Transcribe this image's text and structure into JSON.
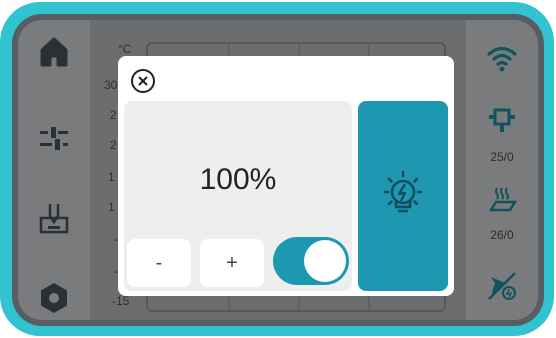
{
  "background_chart": {
    "unit_label": "°C",
    "tick_labels": [
      "30",
      "2",
      "2",
      "1",
      "1",
      "-",
      "-",
      "-15"
    ]
  },
  "sidebar_left": {
    "items": [
      {
        "icon": "home-icon"
      },
      {
        "icon": "sliders-icon"
      },
      {
        "icon": "printer-icon"
      },
      {
        "icon": "settings-hex-icon"
      }
    ]
  },
  "sidebar_right": {
    "wifi_icon": "wifi-icon",
    "nozzle": {
      "icon": "nozzle-icon",
      "value": "25/0"
    },
    "bed": {
      "icon": "heated-bed-icon",
      "value": "26/0"
    },
    "fan_icon": "fan-icon"
  },
  "light_dialog": {
    "close_icon": "close-icon",
    "brightness": "100%",
    "brightness_fraction": 1.0,
    "decrease_label": "-",
    "increase_label": "+",
    "toggle_on": true,
    "light_icon": "bulb-icon"
  },
  "colors": {
    "accent": "#1e97b0",
    "frame": "#31c3cf",
    "dark_icon": "#2f3337"
  }
}
